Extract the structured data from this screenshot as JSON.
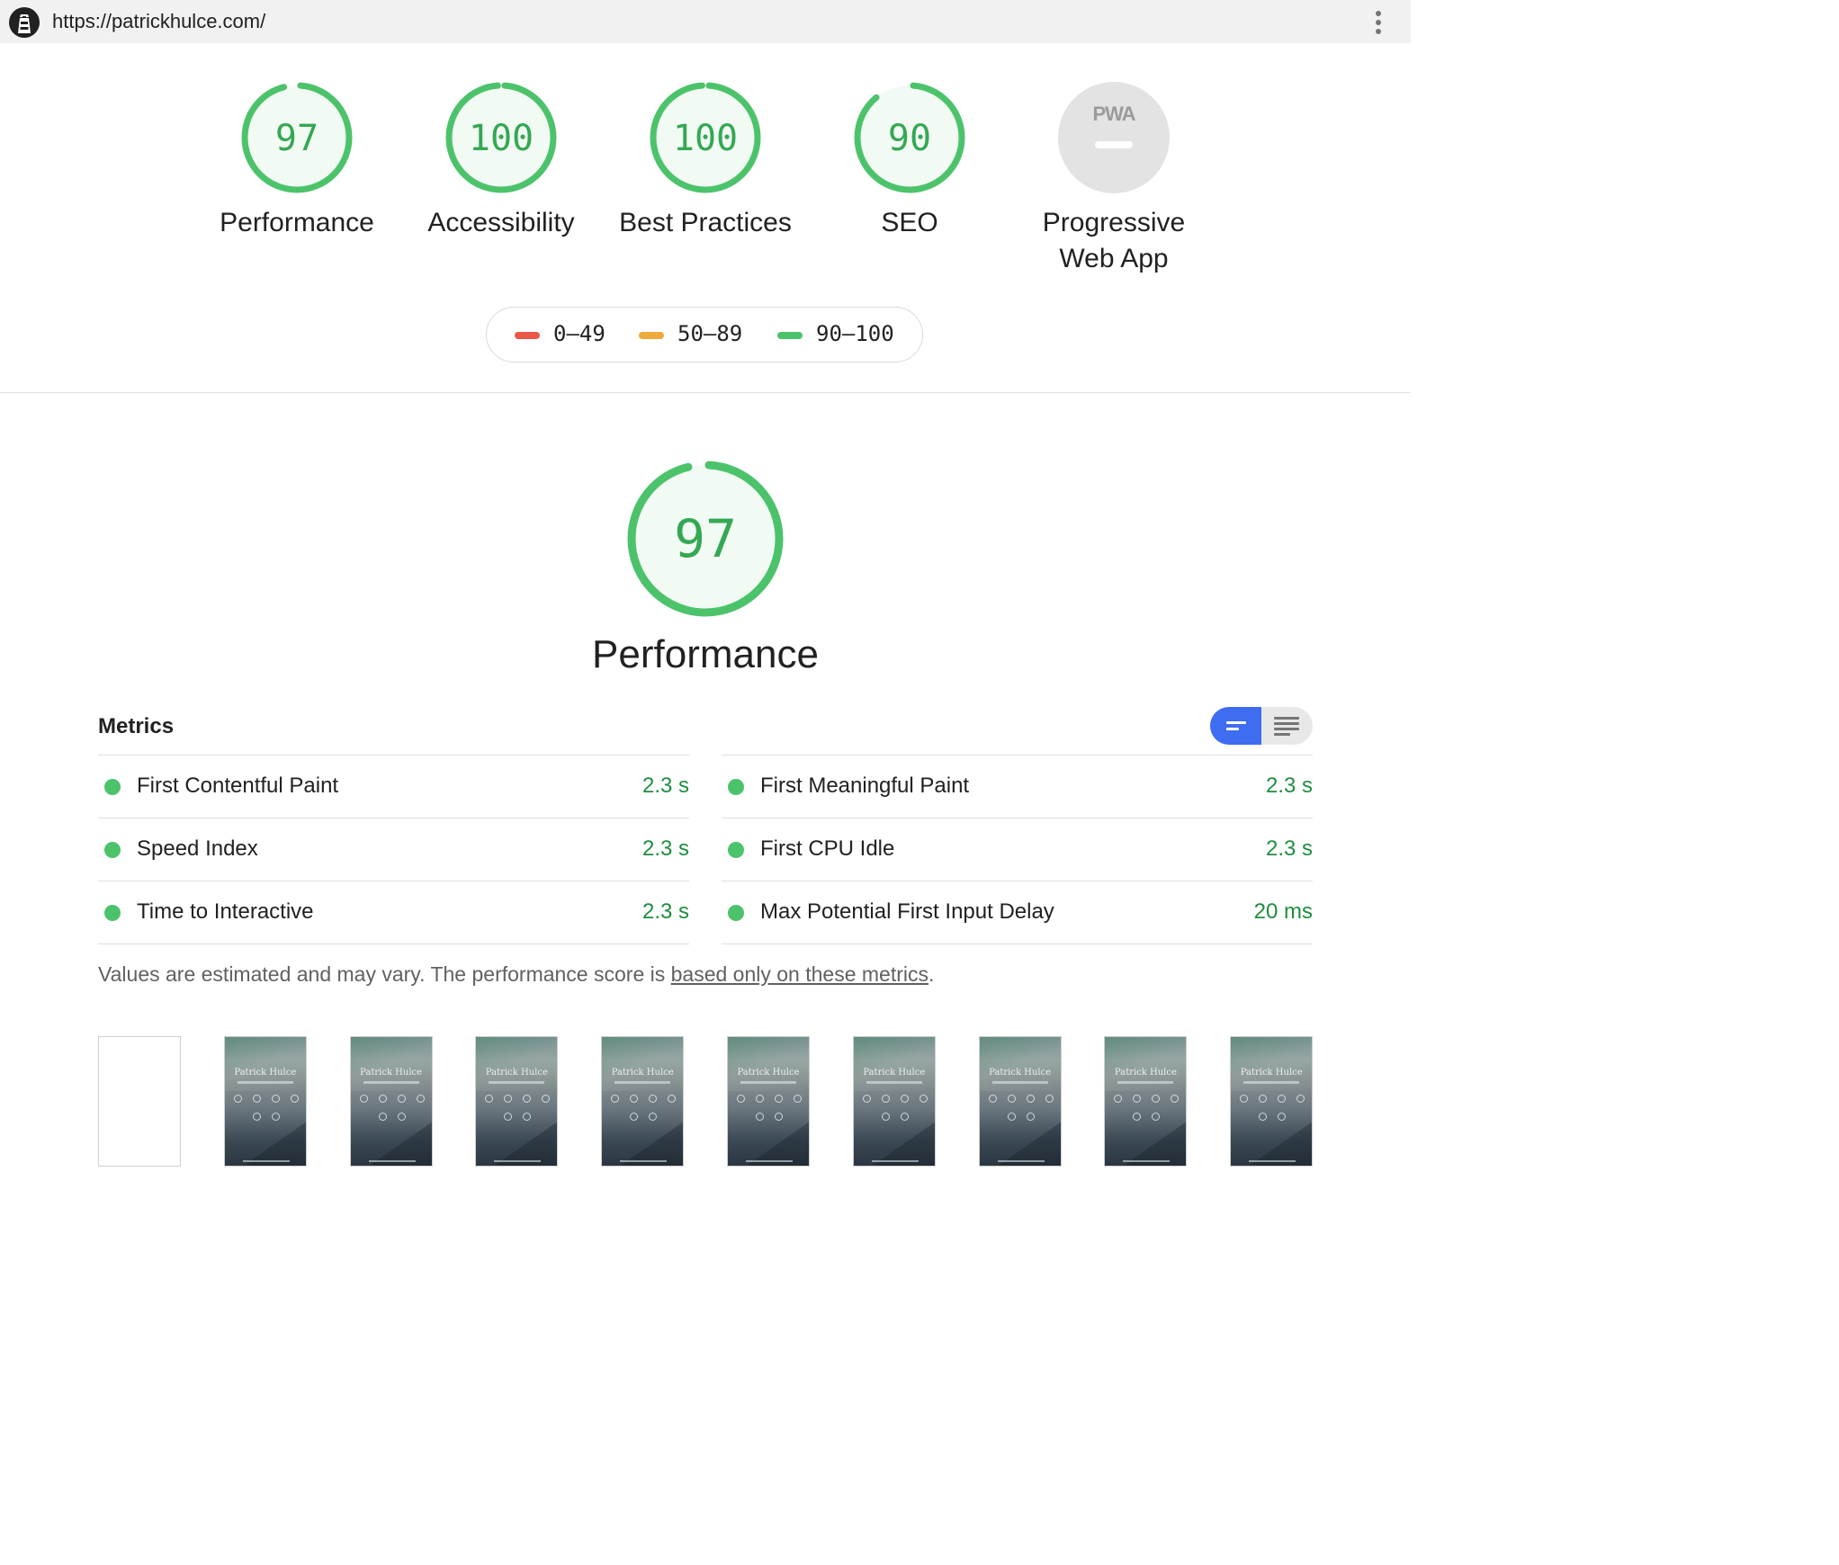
{
  "browser": {
    "url": "https://patrickhulce.com/",
    "logo_icon": "lighthouse-icon",
    "menu_icon": "more-vert-icon"
  },
  "colors": {
    "pass": "#0cce6b",
    "pass_text": "#1e8e3e",
    "average": "#ffa400",
    "fail": "#ff4e42",
    "accent": "#3f6df1"
  },
  "gauges": [
    {
      "score": 97,
      "label": "Performance"
    },
    {
      "score": 100,
      "label": "Accessibility"
    },
    {
      "score": 100,
      "label": "Best Practices"
    },
    {
      "score": 90,
      "label": "SEO"
    },
    {
      "score": null,
      "label_line1": "Progressive",
      "label_line2": "Web App",
      "badge_text": "PWA"
    }
  ],
  "legend": [
    {
      "range": "0–49",
      "color": "#e9594a"
    },
    {
      "range": "50–89",
      "color": "#f0a93b"
    },
    {
      "range": "90–100",
      "color": "#4cc36b"
    }
  ],
  "performance": {
    "score": 97,
    "title": "Performance"
  },
  "metrics": {
    "heading": "Metrics",
    "left": [
      {
        "name": "First Contentful Paint",
        "value": "2.3 s"
      },
      {
        "name": "Speed Index",
        "value": "2.3 s"
      },
      {
        "name": "Time to Interactive",
        "value": "2.3 s"
      }
    ],
    "right": [
      {
        "name": "First Meaningful Paint",
        "value": "2.3 s"
      },
      {
        "name": "First CPU Idle",
        "value": "2.3 s"
      },
      {
        "name": "Max Potential First Input Delay",
        "value": "20 ms"
      }
    ],
    "note_prefix": "Values are estimated and may vary. The performance score is ",
    "note_link": "based only on these metrics",
    "note_suffix": "."
  },
  "filmstrip": {
    "frame_title": "Patrick Hulce",
    "frames": [
      "blank",
      "loaded",
      "loaded",
      "loaded",
      "loaded",
      "loaded",
      "loaded",
      "loaded",
      "loaded",
      "loaded"
    ]
  }
}
